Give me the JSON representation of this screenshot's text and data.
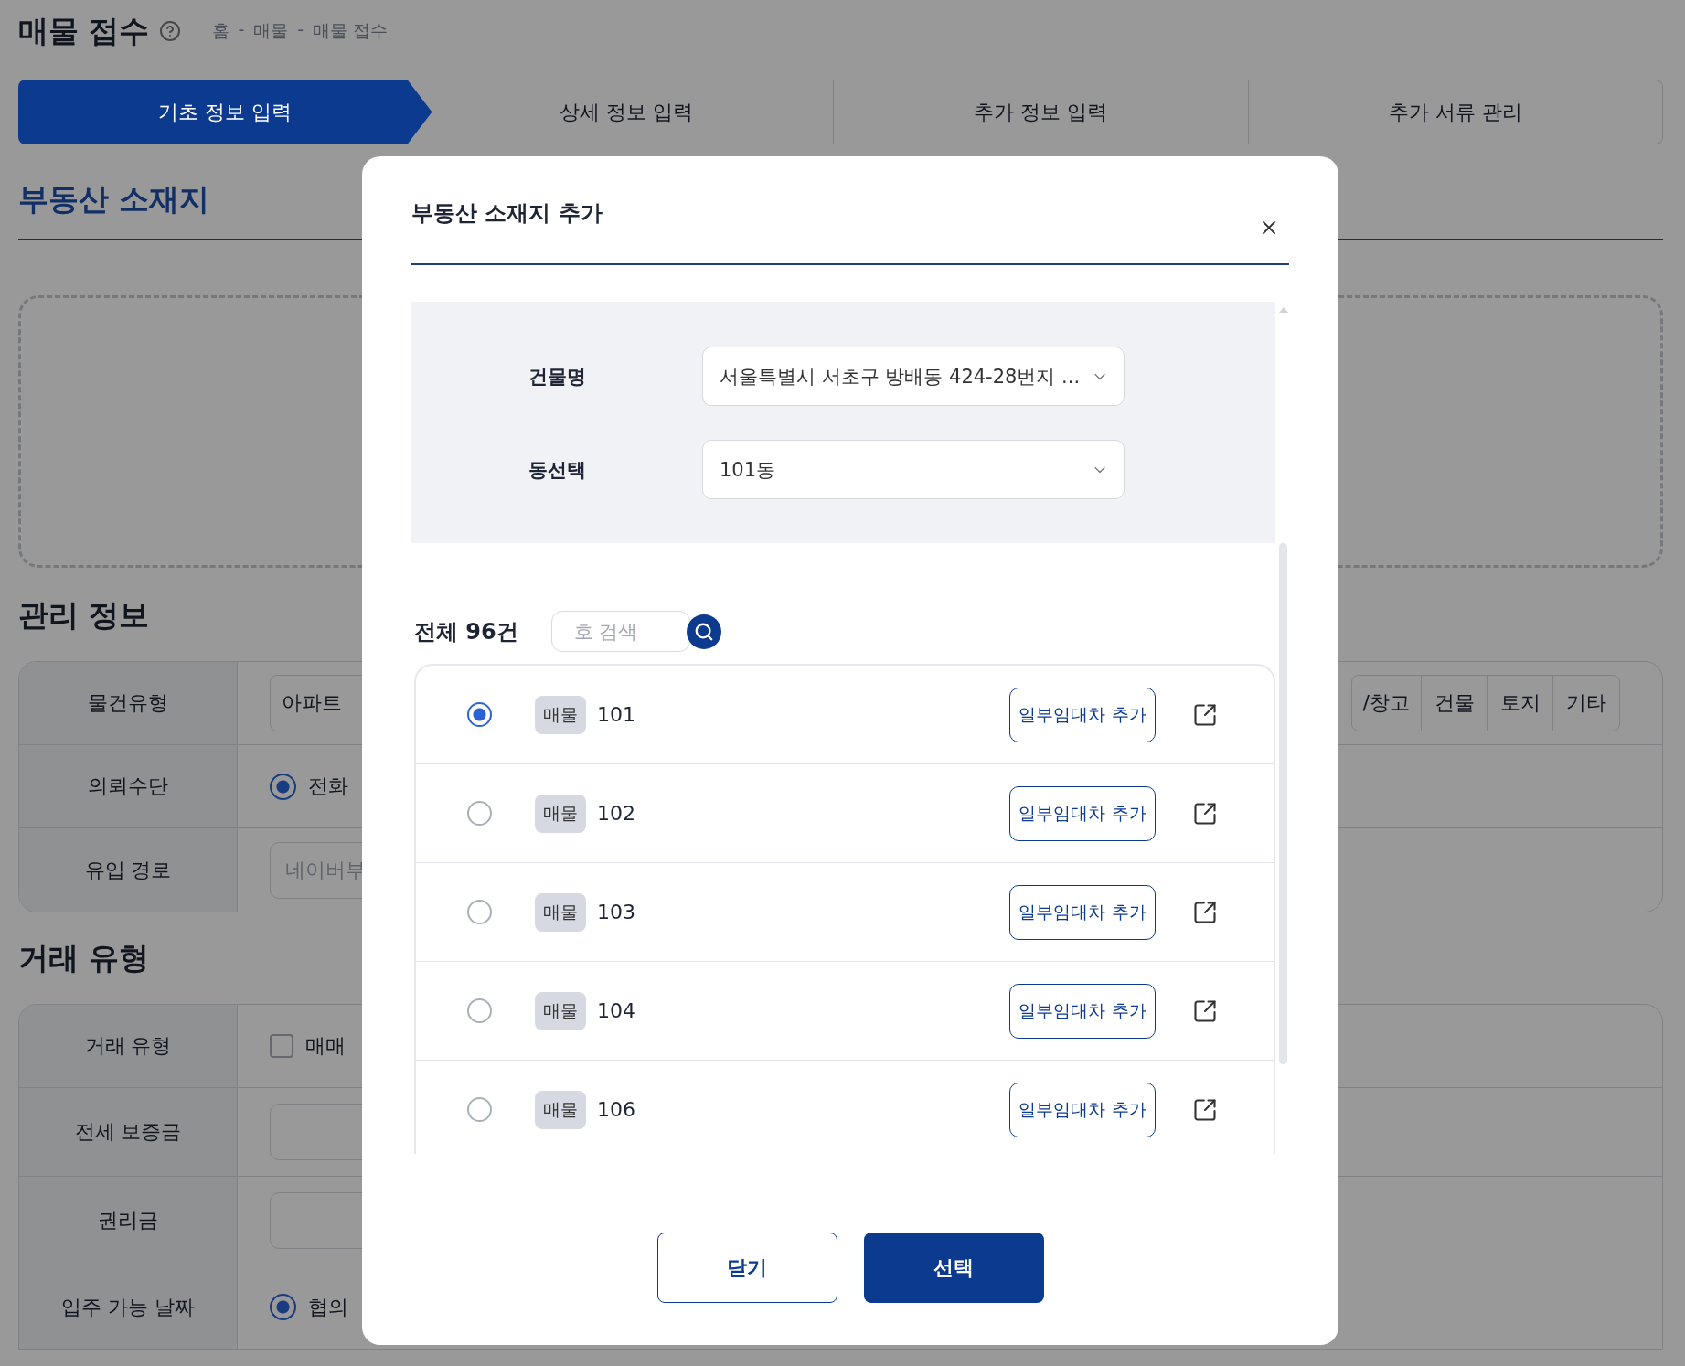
{
  "page": {
    "title": "매물 접수",
    "breadcrumb": [
      "홈",
      "매물",
      "매물 접수"
    ],
    "breadcrumb_separator": "-"
  },
  "steps": [
    {
      "label": "기초 정보 입력",
      "selected": true
    },
    {
      "label": "상세 정보 입력",
      "selected": false
    },
    {
      "label": "추가 정보 입력",
      "selected": false
    },
    {
      "label": "추가 서류 관리",
      "selected": false
    }
  ],
  "location_section": {
    "title": "부동산 소재지"
  },
  "management": {
    "title": "관리 정보",
    "rows": [
      {
        "kind": "segments",
        "label": "물건유형",
        "left_options": [
          "아파트"
        ],
        "right_options": [
          "/창고",
          "건물",
          "토지",
          "기타"
        ]
      },
      {
        "kind": "radio",
        "label": "의뢰수단",
        "option": "전화",
        "selected": true
      },
      {
        "kind": "input",
        "label": "유입 경로",
        "placeholder": "네이버부"
      }
    ]
  },
  "deal": {
    "title": "거래 유형",
    "rows": [
      {
        "kind": "checkbox",
        "label": "거래 유형",
        "option": "매매",
        "checked": false
      },
      {
        "kind": "input",
        "label": "전세 보증금"
      },
      {
        "kind": "input",
        "label": "권리금"
      },
      {
        "kind": "radio",
        "label": "입주 가능 날짜",
        "option": "협의",
        "selected": true
      }
    ]
  },
  "modal": {
    "title": "부동산 소재지 추가",
    "fields": [
      {
        "label": "건물명",
        "value": "서울특별시 서초구 방배동 424-28번지 ..."
      },
      {
        "label": "동선택",
        "value": "101동"
      }
    ],
    "total": "전체 96건",
    "search_placeholder": "호 검색",
    "units": [
      {
        "tag": "매물",
        "number": "101",
        "selected": true,
        "action": "일부임대차 추가"
      },
      {
        "tag": "매물",
        "number": "102",
        "selected": false,
        "action": "일부임대차 추가"
      },
      {
        "tag": "매물",
        "number": "103",
        "selected": false,
        "action": "일부임대차 추가"
      },
      {
        "tag": "매물",
        "number": "104",
        "selected": false,
        "action": "일부임대차 추가"
      },
      {
        "tag": "매물",
        "number": "106",
        "selected": false,
        "action": "일부임대차 추가"
      }
    ],
    "buttons": [
      {
        "label": "닫기",
        "kind": "secondary"
      },
      {
        "label": "선택",
        "kind": "primary"
      }
    ]
  }
}
